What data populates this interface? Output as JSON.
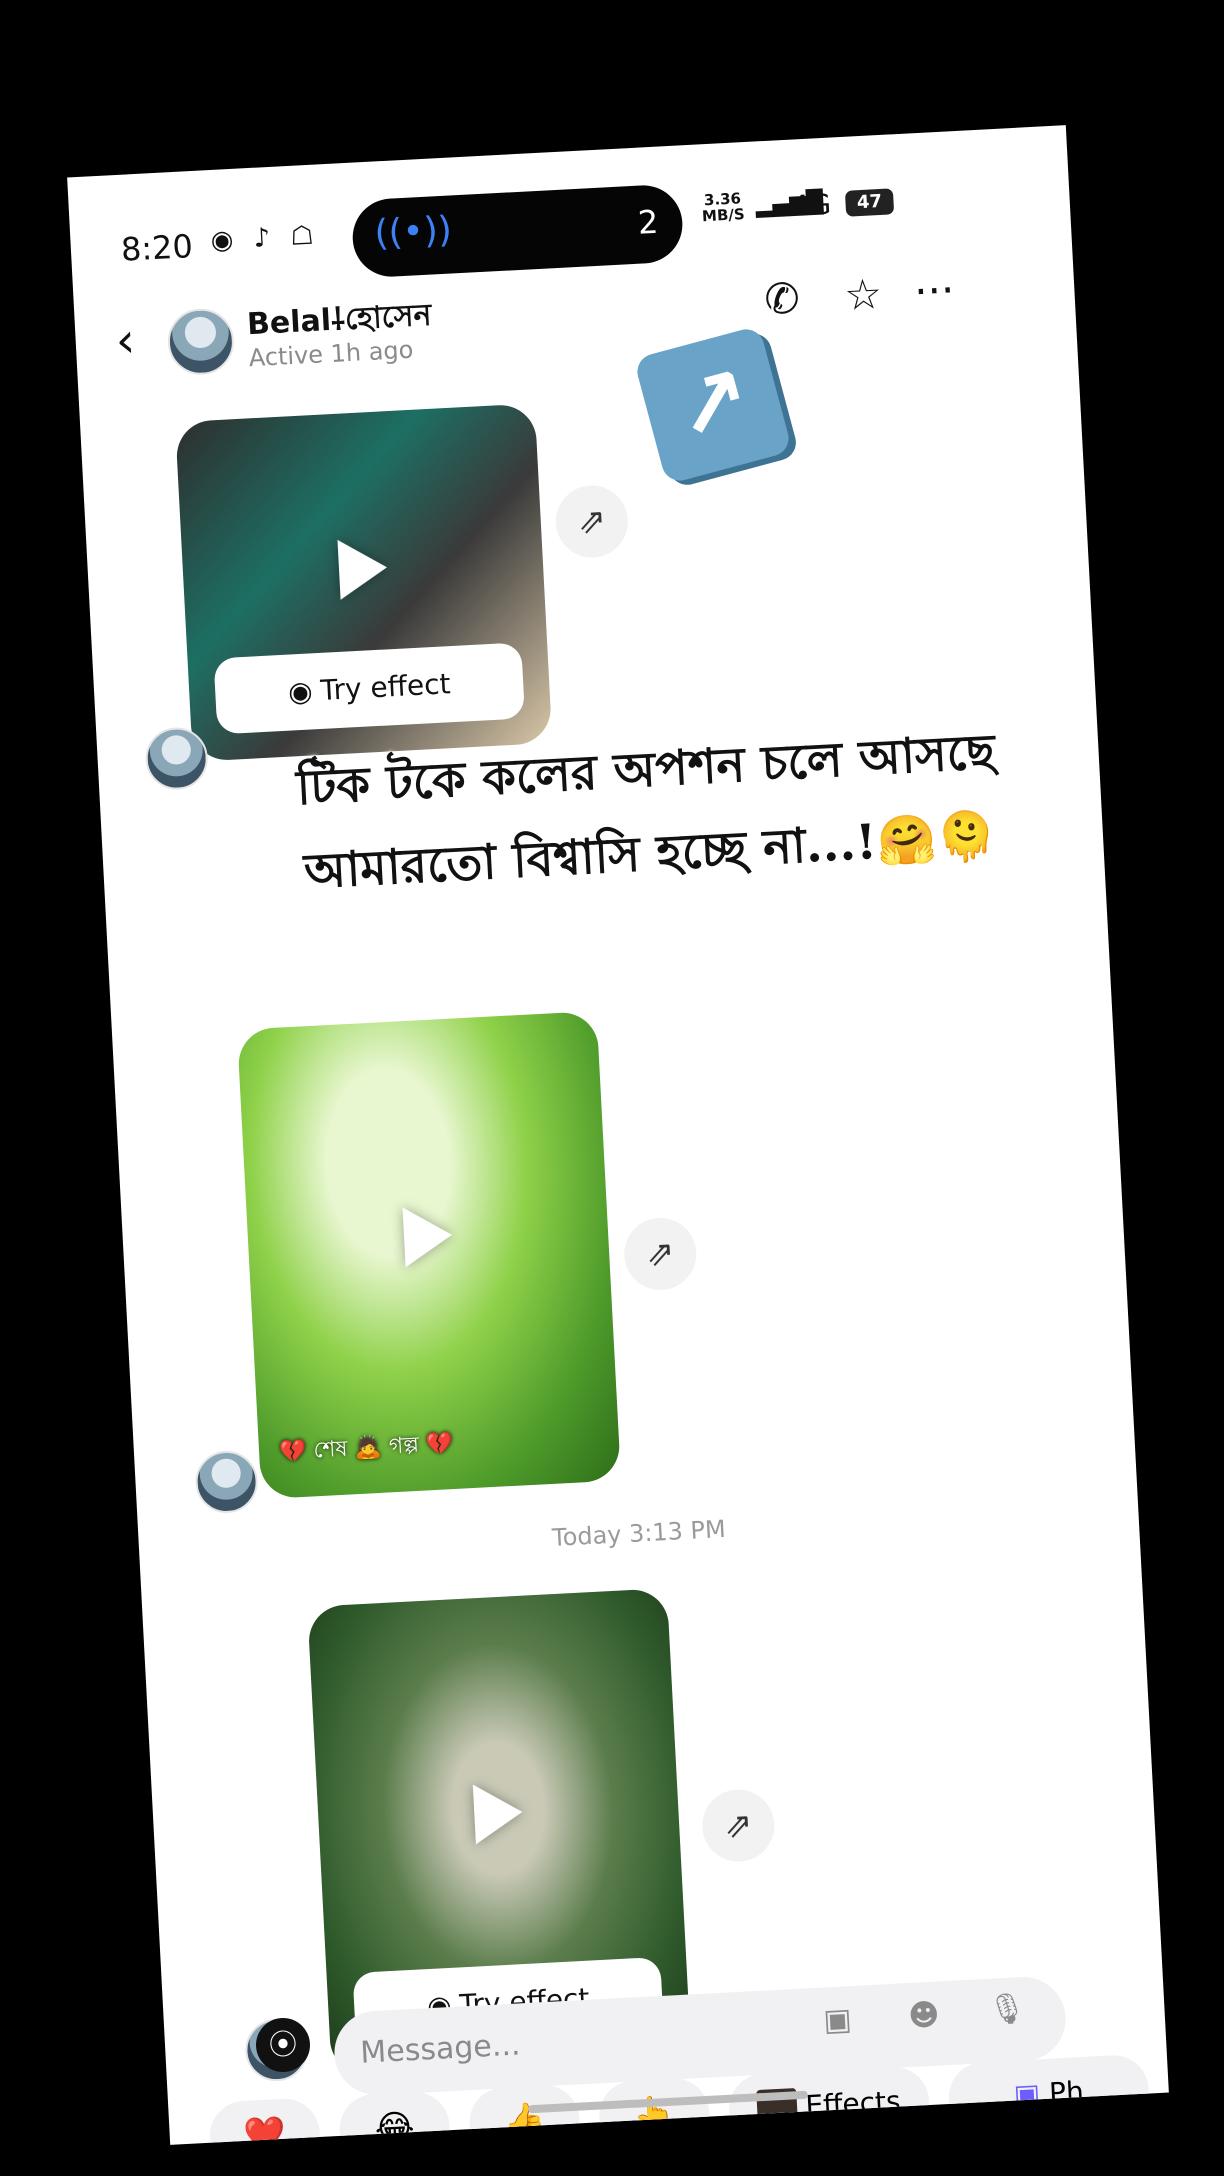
{
  "status_bar": {
    "time": "8:20",
    "notif_icons": "◉ ♪ ☖",
    "island_count": "2",
    "net_speed_value": "3.36",
    "net_speed_unit": "MB/S",
    "network": "4G",
    "battery": "47"
  },
  "header": {
    "back_icon": "‹",
    "name": "Belal⸸হোসেন",
    "status": "Active 1h ago",
    "call_icon": "✆",
    "star_icon": "☆",
    "more_icon": "···"
  },
  "messages": {
    "try_effect_1": "Try effect",
    "caption_2": "💔 শেষ 🙇 গল্প 💔",
    "timestamp": "Today 3:13 PM",
    "try_effect_3": "Try effect",
    "share_icon": "⇗"
  },
  "overlay": {
    "line1": "টিক টকে কলের অপশন চলে আসছে",
    "line2": "আমারতো বিশ্বাসি হচ্ছে না...!🤗🫠",
    "arrow_emoji": "↗"
  },
  "quick_reactions": [
    "❤️",
    "😂",
    "👍",
    "👆"
  ],
  "effects_label": "Effects",
  "photo_label": "Ph",
  "composer": {
    "placeholder": "Message...",
    "camera_icon": "⦿",
    "gallery_icon": "▣",
    "sticker_icon": "☻",
    "mic_icon": "🎙"
  },
  "colors": {
    "accent": "#3b82f6",
    "background": "#ffffff",
    "bezel": "#000000"
  }
}
